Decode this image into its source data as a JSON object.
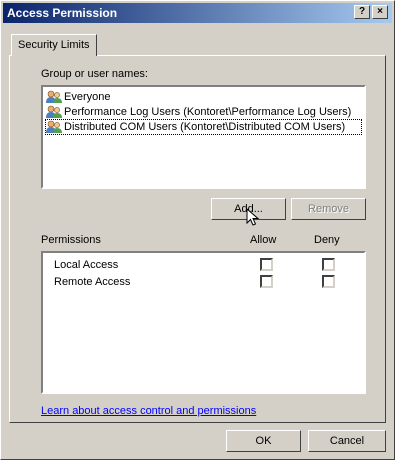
{
  "window": {
    "title": "Access Permission",
    "help_label": "?",
    "close_label": "×"
  },
  "tabs": [
    {
      "label": "Security Limits",
      "selected": true
    }
  ],
  "group_section": {
    "label": "Group or user names:",
    "items": [
      {
        "label": "Everyone",
        "icon": "users-icon",
        "selected": false
      },
      {
        "label": "Performance Log Users (Kontoret\\Performance Log Users)",
        "icon": "users-icon",
        "selected": false
      },
      {
        "label": "Distributed COM Users (Kontoret\\Distributed COM Users)",
        "icon": "users-icon",
        "selected": true
      }
    ],
    "add_label": "Add...",
    "remove_label": "Remove"
  },
  "permissions": {
    "label": "Permissions",
    "allow_header": "Allow",
    "deny_header": "Deny",
    "rows": [
      {
        "label": "Local Access",
        "allow": false,
        "deny": false
      },
      {
        "label": "Remote Access",
        "allow": false,
        "deny": false
      }
    ]
  },
  "link_text": "Learn about access control and permissions",
  "buttons": {
    "ok_label": "OK",
    "cancel_label": "Cancel"
  },
  "colors": {
    "titlebar_start": "#0a246a",
    "titlebar_end": "#a6caf0",
    "face": "#d4d0c8",
    "link": "#0000ff"
  }
}
